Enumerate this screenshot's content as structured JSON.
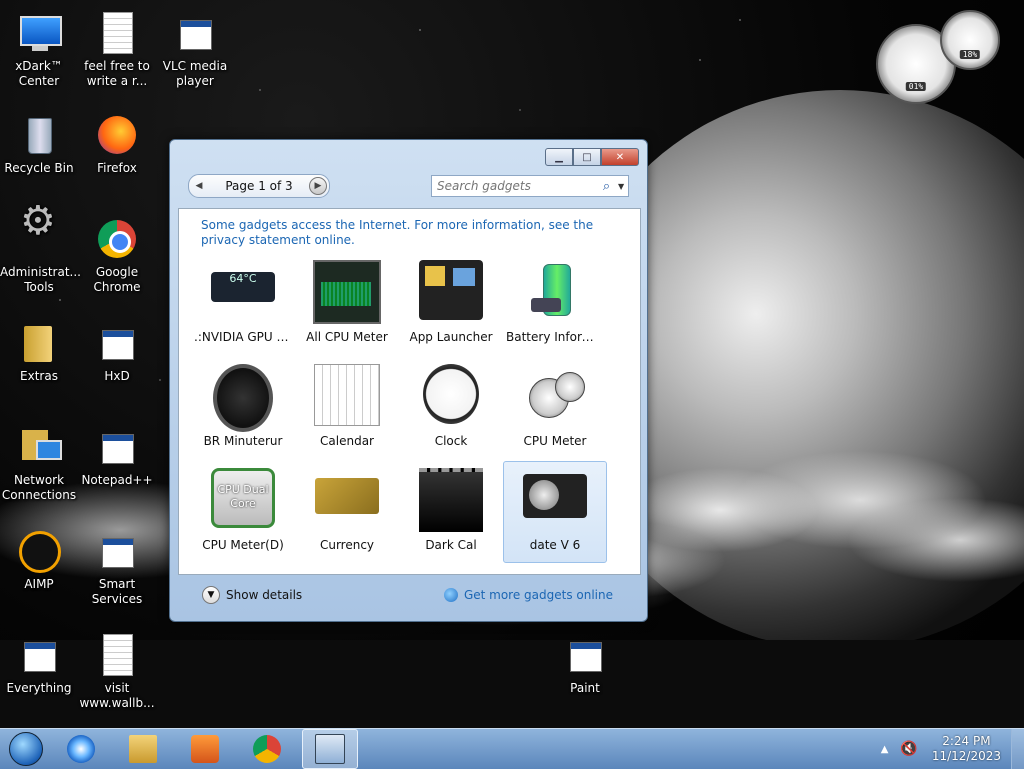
{
  "desktop": {
    "icons": [
      {
        "label": "xDark™ Center",
        "icon": "monitor-icon"
      },
      {
        "label": "feel free to write a r...",
        "icon": "text-file-icon"
      },
      {
        "label": "VLC media player",
        "icon": "vlc-icon"
      },
      {
        "label": "Recycle Bin",
        "icon": "recycle-bin-icon"
      },
      {
        "label": "Firefox",
        "icon": "firefox-icon"
      },
      {
        "label": "Administrat... Tools",
        "icon": "admin-tools-icon"
      },
      {
        "label": "Google Chrome",
        "icon": "chrome-icon"
      },
      {
        "label": "Extras",
        "icon": "folder-icon"
      },
      {
        "label": "HxD",
        "icon": "hxd-icon"
      },
      {
        "label": "Network Connections",
        "icon": "network-icon"
      },
      {
        "label": "Notepad++",
        "icon": "notepad-icon"
      },
      {
        "label": "AIMP",
        "icon": "aimp-icon"
      },
      {
        "label": "Smart Services",
        "icon": "services-icon"
      },
      {
        "label": "Everything",
        "icon": "everything-icon"
      },
      {
        "label": "visit www.wallb...",
        "icon": "text-file-icon"
      },
      {
        "label": "Paint",
        "icon": "paint-icon"
      }
    ]
  },
  "cpu_gadget": {
    "cpu_value": "01%",
    "ram_value": "18%"
  },
  "gallery": {
    "pager_text": "Page 1 of 3",
    "search_placeholder": "Search gadgets",
    "notice": "Some gadgets access the Internet.  For more information, see the privacy statement online.",
    "gadgets": [
      {
        "label": ".:NVIDIA GPU T...",
        "thumb_text": "64°C",
        "selected": false
      },
      {
        "label": "All CPU Meter",
        "selected": false
      },
      {
        "label": "App Launcher",
        "selected": false
      },
      {
        "label": "Battery Informa...",
        "selected": false
      },
      {
        "label": "BR Minuterur",
        "selected": false
      },
      {
        "label": "Calendar",
        "selected": false
      },
      {
        "label": "Clock",
        "selected": false
      },
      {
        "label": "CPU Meter",
        "selected": false
      },
      {
        "label": "CPU Meter(D)",
        "thumb_text": "CPU Dual Core",
        "selected": false
      },
      {
        "label": "Currency",
        "selected": false
      },
      {
        "label": "Dark Cal",
        "selected": false
      },
      {
        "label": "date V 6",
        "selected": true
      }
    ],
    "show_details": "Show details",
    "get_more": "Get more gadgets online"
  },
  "taskbar": {
    "apps": [
      "internet-explorer-icon",
      "windows-explorer-icon",
      "media-player-icon",
      "chrome-icon",
      "gadgets-icon"
    ],
    "time": "2:24 PM",
    "date": "11/12/2023"
  }
}
